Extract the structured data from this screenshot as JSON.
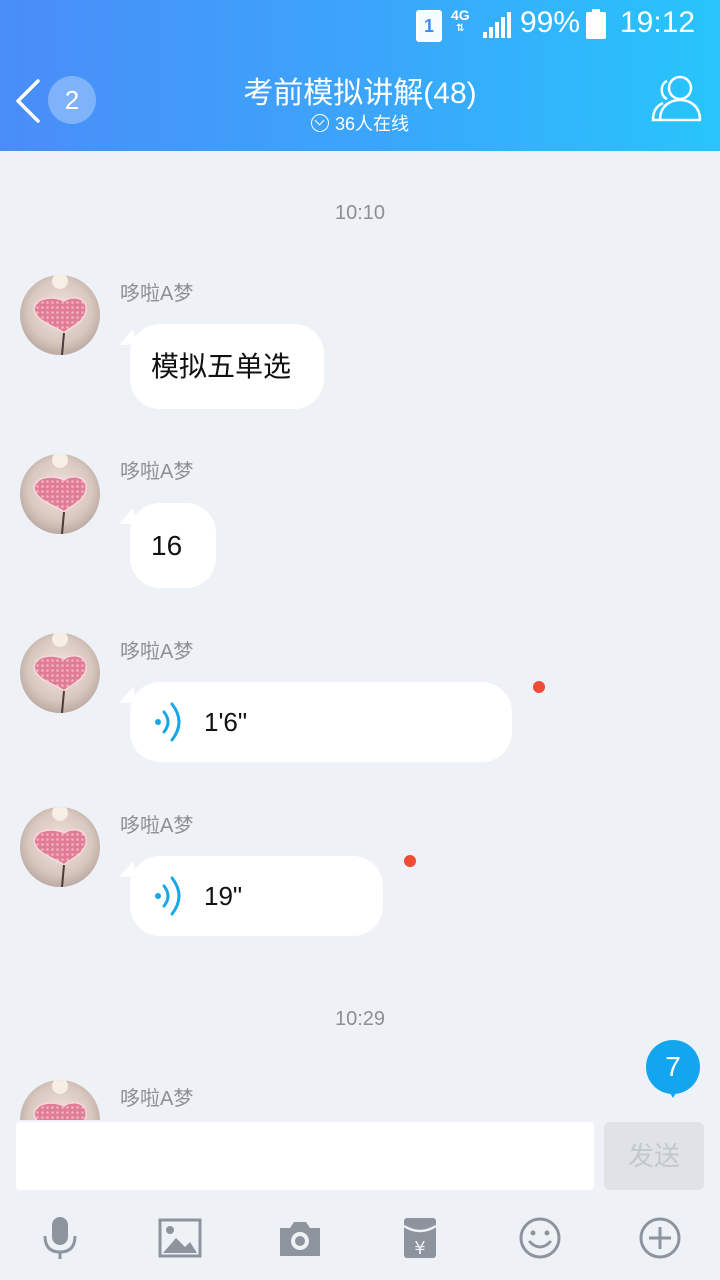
{
  "status_bar": {
    "sim_slot": "1",
    "network": "4G",
    "battery_percent": "99%",
    "time": "19:12"
  },
  "header": {
    "back_badge": "2",
    "title": "考前模拟讲解(48)",
    "subtitle": "36人在线"
  },
  "messages": [
    {
      "time": "10:10"
    },
    {
      "sender": "哆啦A梦",
      "type": "text",
      "text": "模拟五单选"
    },
    {
      "sender": "哆啦A梦",
      "type": "text",
      "text": "16"
    },
    {
      "sender": "哆啦A梦",
      "type": "voice",
      "duration": "1'6\"",
      "unread": true
    },
    {
      "sender": "哆啦A梦",
      "type": "voice",
      "duration": "19\"",
      "unread": true
    },
    {
      "time": "10:29"
    },
    {
      "sender": "哆啦A梦",
      "type": "partial"
    }
  ],
  "new_messages_badge": "7",
  "input": {
    "placeholder": "",
    "send_label": "发送"
  },
  "toolbar": [
    "microphone-icon",
    "image-icon",
    "camera-icon",
    "red-packet-icon",
    "emoji-icon",
    "plus-icon"
  ],
  "colors": {
    "header_gradient_start": "#4a8df8",
    "header_gradient_end": "#27c5fb",
    "background": "#eef1f6",
    "unread_dot": "#ef4b35",
    "badge": "#12a6ee",
    "voice_icon": "#17a7e6"
  }
}
